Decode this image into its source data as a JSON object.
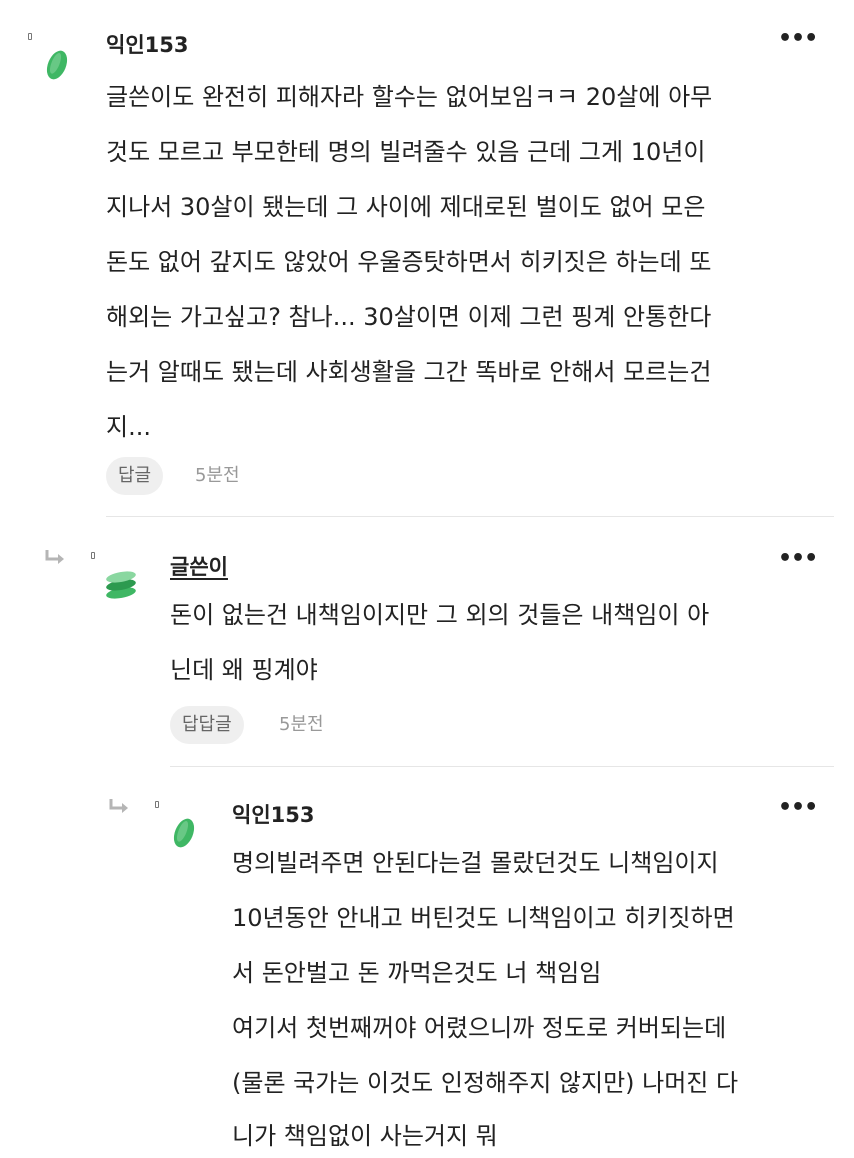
{
  "comments": [
    {
      "author": "익인153",
      "lines": [
        "글쓴이도 완전히 피해자라 할수는 없어보임ㅋㅋ 20살에 아무",
        "것도 모르고 부모한테 명의 빌려줄수 있음 근데 그게 10년이",
        "지나서 30살이 됐는데 그 사이에 제대로된 벌이도 없어 모은",
        "돈도 없어 갚지도 않았어 우울증탓하면서 히키짓은 하는데 또",
        "해외는 가고싶고? 참나... 30살이면 이제 그런 핑계 안통한다",
        "는거 알때도 됐는데 사회생활을 그간 똑바로 안해서 모르는건",
        "지..."
      ],
      "reply_label": "답글",
      "time": "5분전"
    },
    {
      "author": "글쓴이",
      "lines": [
        "돈이 없는건 내책임이지만 그 외의 것들은 내책임이 아",
        "닌데 왜 핑계야"
      ],
      "reply_label": "답답글",
      "time": "5분전"
    },
    {
      "author": "익인153",
      "lines": [
        "명의빌려주면 안된다는걸 몰랐던것도 니책임이지",
        "10년동안 안내고 버틴것도 니책임이고 히키짓하면",
        "서 돈안벌고 돈 까먹은것도 너 책임임",
        "여기서 첫번째꺼야 어렸으니까 정도로 커버되는데",
        "(물론 국가는 이것도 인정해주지 않지만) 나머진 다",
        "니가 책임없이 사는거지 뭐"
      ]
    }
  ],
  "more_label": "•••",
  "colors": {
    "avatar_green": "#3fb764",
    "avatar_light": "#8ad7a0",
    "avatar_dark": "#2c9a4f"
  }
}
